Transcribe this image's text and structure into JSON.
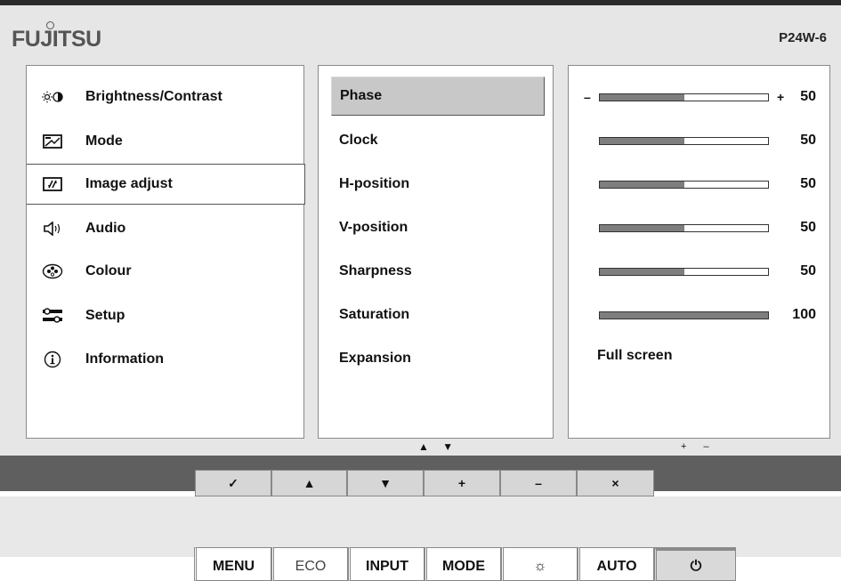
{
  "header": {
    "logo_text": "FUJITSU",
    "model": "P24W-6"
  },
  "main_menu": {
    "items": [
      {
        "label": "Brightness/Contrast",
        "icon": "brightness-contrast-icon"
      },
      {
        "label": "Mode",
        "icon": "mode-icon"
      },
      {
        "label": "Image adjust",
        "icon": "image-adjust-icon",
        "active": true
      },
      {
        "label": "Audio",
        "icon": "speaker-icon"
      },
      {
        "label": "Colour",
        "icon": "colour-icon"
      },
      {
        "label": "Setup",
        "icon": "setup-icon"
      },
      {
        "label": "Information",
        "icon": "info-icon"
      }
    ]
  },
  "sub_menu": {
    "items": [
      {
        "label": "Phase",
        "active": true
      },
      {
        "label": "Clock"
      },
      {
        "label": "H-position"
      },
      {
        "label": "V-position"
      },
      {
        "label": "Sharpness"
      },
      {
        "label": "Saturation"
      },
      {
        "label": "Expansion"
      }
    ],
    "nav_hint": "▲ ▼"
  },
  "values": {
    "items": [
      {
        "type": "slider",
        "value": 50,
        "max": 100,
        "display": "50",
        "active": true,
        "minus_label": "–",
        "plus_label": "+"
      },
      {
        "type": "slider",
        "value": 50,
        "max": 100,
        "display": "50"
      },
      {
        "type": "slider",
        "value": 50,
        "max": 100,
        "display": "50"
      },
      {
        "type": "slider",
        "value": 50,
        "max": 100,
        "display": "50"
      },
      {
        "type": "slider",
        "value": 50,
        "max": 100,
        "display": "50"
      },
      {
        "type": "slider",
        "value": 100,
        "max": 100,
        "display": "100"
      },
      {
        "type": "text",
        "display": "Full screen"
      }
    ],
    "adjust_hint": "+ –"
  },
  "osd_buttons": [
    {
      "label": "✓",
      "icon": "check-icon"
    },
    {
      "label": "▲",
      "icon": "up-arrow-icon"
    },
    {
      "label": "▼",
      "icon": "down-arrow-icon"
    },
    {
      "label": "+",
      "icon": "plus-icon"
    },
    {
      "label": "–",
      "icon": "minus-icon"
    },
    {
      "label": "×",
      "icon": "close-icon"
    }
  ],
  "hardware_buttons": [
    {
      "label": "MENU"
    },
    {
      "label": "ECO"
    },
    {
      "label": "INPUT"
    },
    {
      "label": "MODE"
    },
    {
      "label": "☼",
      "icon": "brightness-icon"
    },
    {
      "label": "AUTO"
    },
    {
      "label": "⏻",
      "icon": "power-icon"
    }
  ],
  "colors": {
    "panel_bg": "#ffffff",
    "osd_bg": "#e6e6e6",
    "highlight": "#c8c8c8",
    "slider_fill": "#7e7e7e",
    "button_bar": "#5f5f5f"
  }
}
